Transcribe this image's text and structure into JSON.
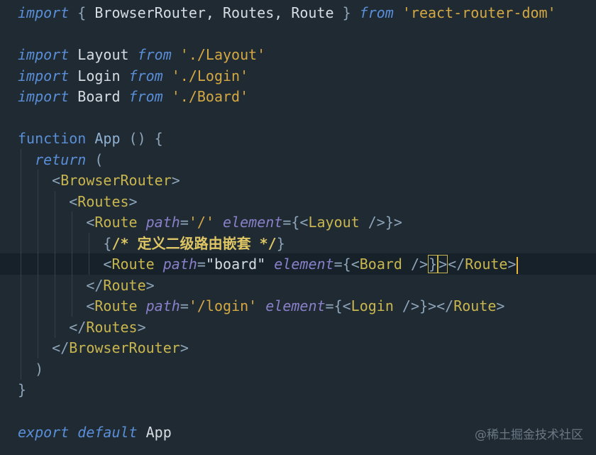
{
  "code": {
    "l1": {
      "import": "import",
      "open": " { ",
      "names": "BrowserRouter, Routes, Route",
      "close": " } ",
      "from": "from",
      "sp": " ",
      "src": "'react-router-dom'"
    },
    "l3": {
      "import": "import",
      "name": " Layout ",
      "from": "from",
      "src": " './Layout'"
    },
    "l4": {
      "import": "import",
      "name": " Login ",
      "from": "from",
      "src": " './Login'"
    },
    "l5": {
      "import": "import",
      "name": " Board ",
      "from": "from",
      "src": " './Board'"
    },
    "l7": {
      "function": "function",
      "name": " App ",
      "parens": "() {"
    },
    "l8": {
      "return": "return",
      "paren": " ("
    },
    "l9": {
      "open": "<",
      "tag": "BrowserRouter",
      "close": ">"
    },
    "l10": {
      "open": "<",
      "tag": "Routes",
      "close": ">"
    },
    "l11": {
      "open": "<",
      "tag": "Route",
      "sp1": " ",
      "path_attr": "path",
      "eq1": "=",
      "path_val": "'/'",
      "sp2": " ",
      "el_attr": "element",
      "eq2": "={",
      "inner_open": "<",
      "inner_tag": "Layout",
      "inner_close": " />",
      "end": "}>"
    },
    "l12": {
      "brace_open": "{",
      "comment": "/* 定义二级路由嵌套 */",
      "brace_close": "}"
    },
    "l13": {
      "open": "<",
      "tag": "Route",
      "sp1": " ",
      "path_attr": "path",
      "eq1": "=",
      "path_val": "\"board\"",
      "sp2": " ",
      "el_attr": "element",
      "eq2": "={",
      "inner_open": "<",
      "inner_tag": "Board",
      "inner_close": " />",
      "brace_close": "}",
      "gt": ">",
      "close_open": "</",
      "close_tag": "Route",
      "close_gt": ">"
    },
    "l14": {
      "open": "</",
      "tag": "Route",
      "close": ">"
    },
    "l15": {
      "open": "<",
      "tag": "Route",
      "sp1": " ",
      "path_attr": "path",
      "eq1": "=",
      "path_val": "'/login'",
      "sp2": " ",
      "el_attr": "element",
      "eq2": "={",
      "inner_open": "<",
      "inner_tag": "Login",
      "inner_close": " />",
      "end": "}>",
      "close_open": "</",
      "close_tag": "Route",
      "close_gt": ">"
    },
    "l16": {
      "open": "</",
      "tag": "Routes",
      "close": ">"
    },
    "l17": {
      "open": "</",
      "tag": "BrowserRouter",
      "close": ">"
    },
    "l18": {
      "text": ")"
    },
    "l19": {
      "text": "}"
    },
    "l21": {
      "export": "export",
      "sp": " ",
      "default": "default",
      "name": " App"
    }
  },
  "watermark": "@稀土掘金技术社区",
  "colors": {
    "background": "#1f2a33",
    "keyword": "#5a8fd8",
    "string": "#d4a843",
    "tag": "#c9b64e",
    "attribute": "#8a80c9",
    "comment": "#dfc665",
    "cursor": "#e8b43a"
  }
}
